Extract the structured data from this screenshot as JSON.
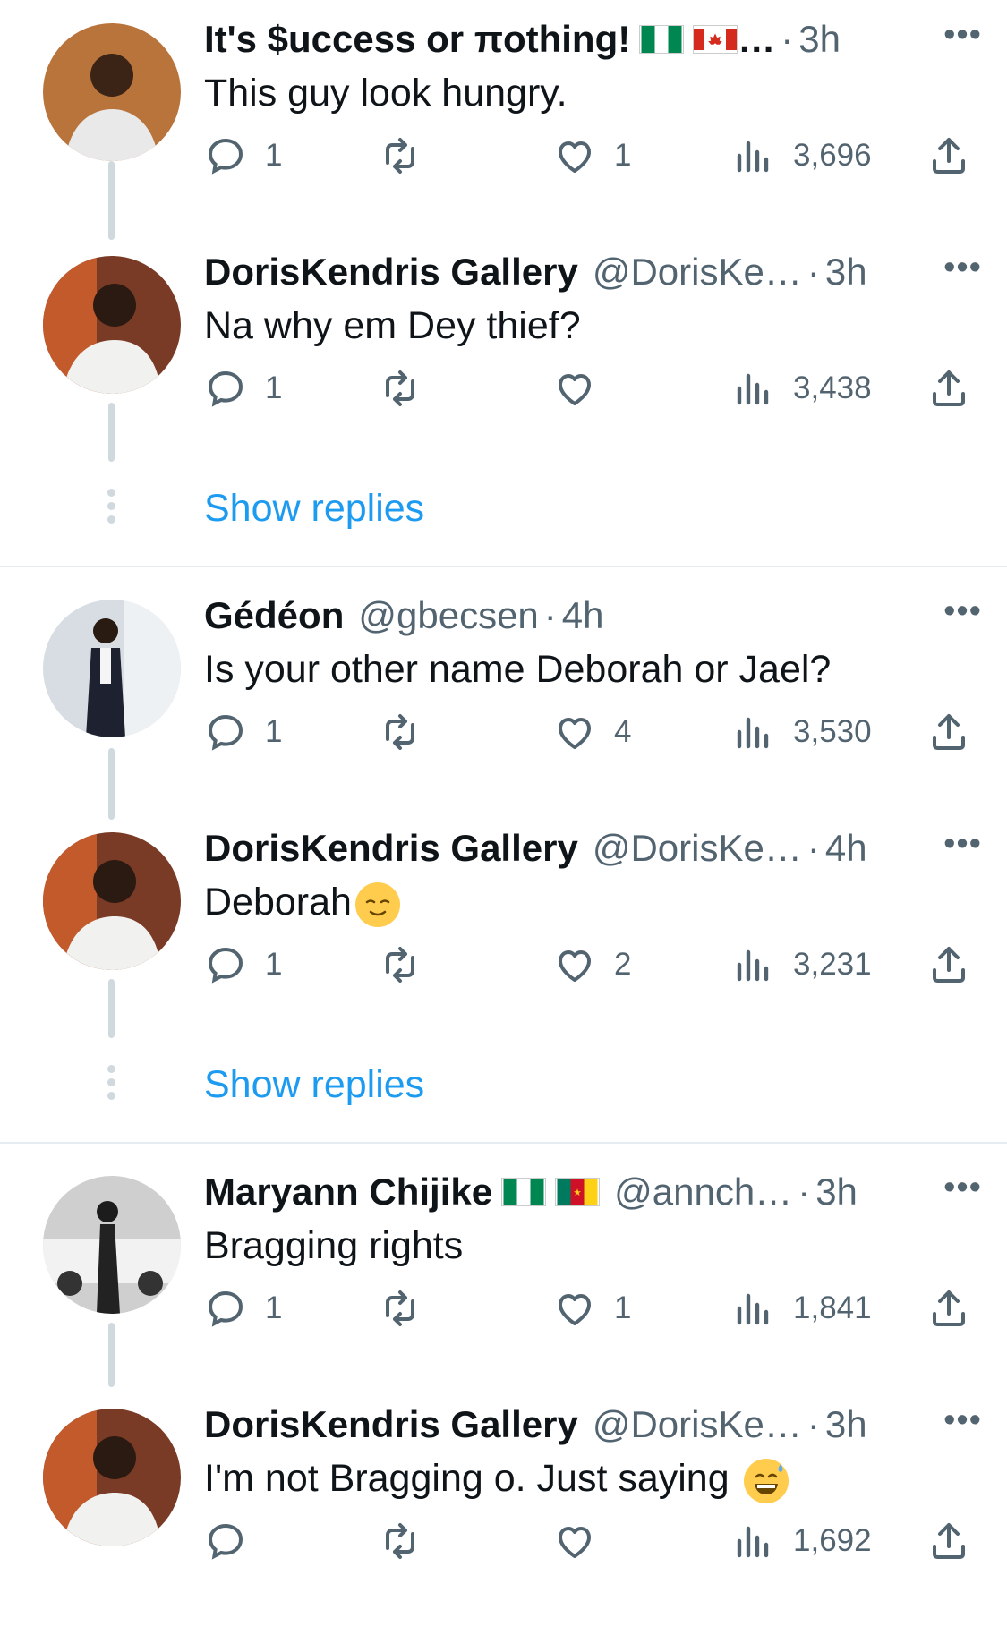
{
  "tweets": [
    {
      "name": "It's $uccess or πothing! ",
      "handle": "…",
      "time": "3h",
      "text": "This guy look hungry.",
      "reply_count": "1",
      "retweet_count": "",
      "like_count": "1",
      "views": "3,696"
    },
    {
      "name": "DorisKendris Gallery",
      "handle": "@DorisKe…",
      "time": "3h",
      "text": "Na why em Dey thief?",
      "reply_count": "1",
      "retweet_count": "",
      "like_count": "",
      "views": "3,438"
    },
    {
      "name": "Gédéon",
      "handle": "@gbecsen",
      "time": "4h",
      "text": "Is your other name Deborah or Jael?",
      "reply_count": "1",
      "retweet_count": "",
      "like_count": "4",
      "views": "3,530"
    },
    {
      "name": "DorisKendris Gallery",
      "handle": "@DorisKe…",
      "time": "4h",
      "text": "Deborah",
      "reply_count": "1",
      "retweet_count": "",
      "like_count": "2",
      "views": "3,231"
    },
    {
      "name": "Maryann Chijike",
      "handle": "@annch…",
      "time": "3h",
      "text": "Bragging rights",
      "reply_count": "1",
      "retweet_count": "",
      "like_count": "1",
      "views": "1,841"
    },
    {
      "name": "DorisKendris Gallery",
      "handle": "@DorisKe…",
      "time": "3h",
      "text": "I'm not Bragging o. Just saying",
      "reply_count": "",
      "retweet_count": "",
      "like_count": "",
      "views": "1,692"
    }
  ],
  "show_replies_label": "Show replies",
  "dot_sep": "·",
  "more_label": "•••",
  "colors": {
    "accent": "#1d9bf0",
    "secondary_text": "#536471",
    "thread_line": "#cfd9de"
  },
  "icons": [
    "reply-icon",
    "retweet-icon",
    "like-icon",
    "views-icon",
    "share-icon",
    "more-icon"
  ]
}
